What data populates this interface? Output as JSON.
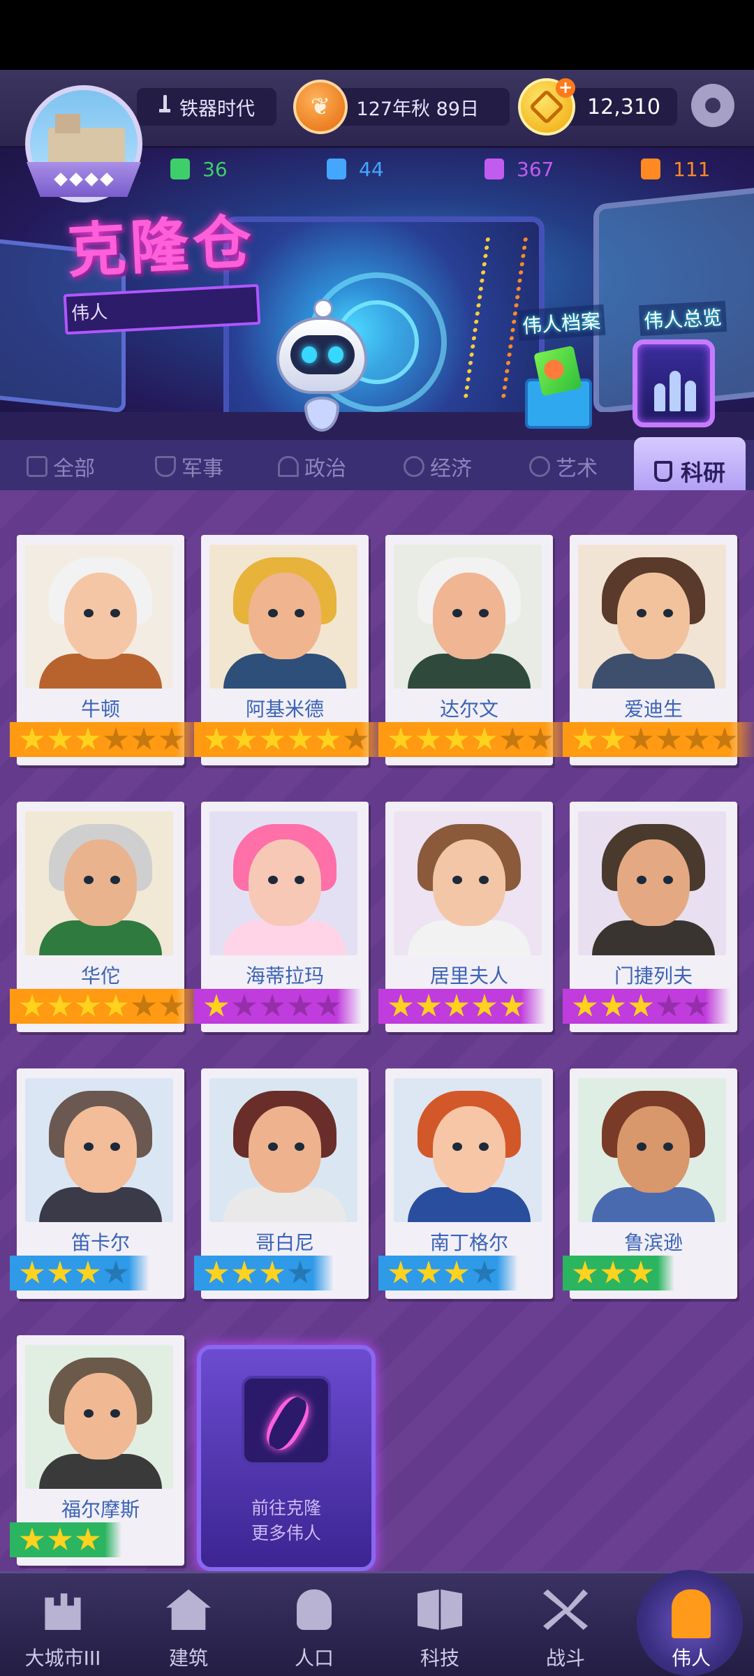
{
  "header": {
    "era": "铁器时代",
    "date": "127年秋 89日",
    "gold": "12,310",
    "resources": [
      {
        "value": "36",
        "color": "#3ecf6a"
      },
      {
        "value": "44",
        "color": "#44a6ff"
      },
      {
        "value": "367",
        "color": "#c25cf0"
      },
      {
        "value": "111",
        "color": "#ff8a24"
      }
    ]
  },
  "banner": {
    "title": "克隆仓",
    "subtitle": "伟人",
    "archive_label": "伟人档案",
    "overview_label": "伟人总览"
  },
  "tabs": [
    {
      "label": "全部"
    },
    {
      "label": "军事"
    },
    {
      "label": "政治"
    },
    {
      "label": "经济"
    },
    {
      "label": "艺术"
    },
    {
      "label": "科研",
      "active": true
    }
  ],
  "great_people": [
    {
      "name": "牛顿",
      "stars": 3,
      "max_stars": 6,
      "tier_color": "#ff9a12",
      "bg": "#f3ece2",
      "skin": "#f5c6a6",
      "hair": "#f2f2f2",
      "cloth": "#b8632d"
    },
    {
      "name": "阿基米德",
      "stars": 5,
      "max_stars": 6,
      "tier_color": "#ff9a12",
      "bg": "#f3e6d0",
      "skin": "#f0b58f",
      "hair": "#e7b33a",
      "cloth": "#2e4f7a"
    },
    {
      "name": "达尔文",
      "stars": 4,
      "max_stars": 6,
      "tier_color": "#ff9a12",
      "bg": "#e8ece4",
      "skin": "#f0b592",
      "hair": "#f2f2f2",
      "cloth": "#2f4a3c"
    },
    {
      "name": "爱迪生",
      "stars": 2,
      "max_stars": 6,
      "tier_color": "#ff9a12",
      "bg": "#f2e4d4",
      "skin": "#f2c29d",
      "hair": "#5a3a2a",
      "cloth": "#3d4f6c"
    },
    {
      "name": "华佗",
      "stars": 4,
      "max_stars": 6,
      "tier_color": "#ff9a12",
      "bg": "#f1e8d6",
      "skin": "#e9b38e",
      "hair": "#cfcfcf",
      "cloth": "#2f7a3e"
    },
    {
      "name": "海蒂拉玛",
      "stars": 1,
      "max_stars": 5,
      "tier_color": "#c03cdc",
      "bg": "#e4e0f4",
      "skin": "#f7c8b6",
      "hair": "#ff6fa8",
      "cloth": "#ffd4e6"
    },
    {
      "name": "居里夫人",
      "stars": 5,
      "max_stars": 5,
      "tier_color": "#c03cdc",
      "bg": "#ede3f2",
      "skin": "#f4c6a8",
      "hair": "#8a5a3a",
      "cloth": "#f2f2f2"
    },
    {
      "name": "门捷列夫",
      "stars": 3,
      "max_stars": 5,
      "tier_color": "#c03cdc",
      "bg": "#e8dff0",
      "skin": "#e4a983",
      "hair": "#4a3a2e",
      "cloth": "#3a3430"
    },
    {
      "name": "笛卡尔",
      "stars": 3,
      "max_stars": 4,
      "tier_color": "#2e9ae8",
      "bg": "#dbe6f4",
      "skin": "#f2bd98",
      "hair": "#6b5850",
      "cloth": "#3b3a48"
    },
    {
      "name": "哥白尼",
      "stars": 3,
      "max_stars": 4,
      "tier_color": "#2e9ae8",
      "bg": "#dae7f3",
      "skin": "#eeb28e",
      "hair": "#6a2e2a",
      "cloth": "#e9e9e9"
    },
    {
      "name": "南丁格尔",
      "stars": 3,
      "max_stars": 4,
      "tier_color": "#2e9ae8",
      "bg": "#dde6f3",
      "skin": "#f7c6a6",
      "hair": "#d2582a",
      "cloth": "#2a4e9e"
    },
    {
      "name": "鲁滨逊",
      "stars": 3,
      "max_stars": 3,
      "tier_color": "#2bb560",
      "bg": "#dfeee4",
      "skin": "#d9976c",
      "hair": "#7a3a28",
      "cloth": "#4a6ab0"
    },
    {
      "name": "福尔摩斯",
      "stars": 3,
      "max_stars": 3,
      "tier_color": "#2bb560",
      "bg": "#e1efe3",
      "skin": "#f0b994",
      "hair": "#6b5a4a",
      "cloth": "#3a3a3a"
    }
  ],
  "clone_more": {
    "line1": "前往克隆",
    "line2": "更多伟人"
  },
  "bottom_nav": [
    {
      "label": "大城市III",
      "icon": "castle-icon"
    },
    {
      "label": "建筑",
      "icon": "house-icon"
    },
    {
      "label": "人口",
      "icon": "person-icon"
    },
    {
      "label": "科技",
      "icon": "book-icon"
    },
    {
      "label": "战斗",
      "icon": "swords-icon"
    },
    {
      "label": "伟人",
      "icon": "statue-icon",
      "active": true
    }
  ]
}
